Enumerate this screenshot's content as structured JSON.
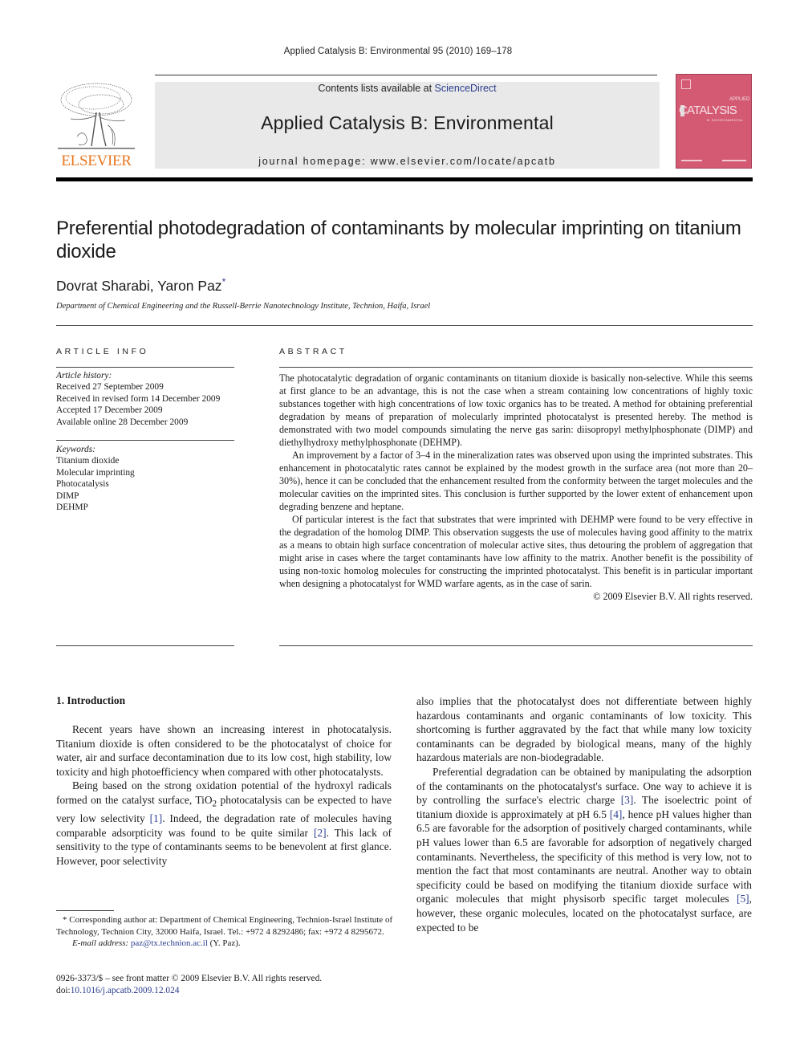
{
  "running_head": "Applied Catalysis B: Environmental 95 (2010) 169–178",
  "publisher": {
    "logo_word": "ELSEVIER",
    "logo_color": "#e87722"
  },
  "banner": {
    "contents_prefix": "Contents lists available at ",
    "contents_link": "ScienceDirect",
    "journal_name": "Applied Catalysis B: Environmental",
    "homepage": "journal homepage: www.elsevier.com/locate/apcatb"
  },
  "cover": {
    "applied": "APPLIED",
    "catalysis": "CATALYSIS",
    "subtitle": "B: ENVIRONMENTAL",
    "color": "#d45a73"
  },
  "article": {
    "title": "Preferential photodegradation of contaminants by molecular imprinting on titanium dioxide",
    "authors": "Dovrat Sharabi, Yaron Paz",
    "author_mark": "*",
    "affiliation": "Department of Chemical Engineering and the Russell-Berrie Nanotechnology Institute, Technion, Haifa, Israel"
  },
  "article_info": {
    "heading": "ARTICLE INFO",
    "history_label": "Article history:",
    "history": [
      "Received 27 September 2009",
      "Received in revised form 14 December 2009",
      "Accepted 17 December 2009",
      "Available online 28 December 2009"
    ],
    "keywords_label": "Keywords:",
    "keywords": [
      "Titanium dioxide",
      "Molecular imprinting",
      "Photocatalysis",
      "DIMP",
      "DEHMP"
    ]
  },
  "abstract": {
    "heading": "ABSTRACT",
    "paragraphs": [
      "The photocatalytic degradation of organic contaminants on titanium dioxide is basically non-selective. While this seems at first glance to be an advantage, this is not the case when a stream containing low concentrations of highly toxic substances together with high concentrations of low toxic organics has to be treated. A method for obtaining preferential degradation by means of preparation of molecularly imprinted photocatalyst is presented hereby. The method is demonstrated with two model compounds simulating the nerve gas sarin: diisopropyl methylphosphonate (DIMP) and diethylhydroxy methylphosphonate (DEHMP).",
      "An improvement by a factor of 3–4 in the mineralization rates was observed upon using the imprinted substrates. This enhancement in photocatalytic rates cannot be explained by the modest growth in the surface area (not more than 20–30%), hence it can be concluded that the enhancement resulted from the conformity between the target molecules and the molecular cavities on the imprinted sites. This conclusion is further supported by the lower extent of enhancement upon degrading benzene and heptane.",
      "Of particular interest is the fact that substrates that were imprinted with DEHMP were found to be very effective in the degradation of the homolog DIMP. This observation suggests the use of molecules having good affinity to the matrix as a means to obtain high surface concentration of molecular active sites, thus detouring the problem of aggregation that might arise in cases where the target contaminants have low affinity to the matrix. Another benefit is the possibility of using non-toxic homolog molecules for constructing the imprinted photocatalyst. This benefit is in particular important when designing a photocatalyst for WMD warfare agents, as in the case of sarin."
    ],
    "copyright": "© 2009 Elsevier B.V. All rights reserved."
  },
  "introduction": {
    "heading": "1.  Introduction",
    "left_col": {
      "p1": "Recent years have shown an increasing interest in photocatalysis. Titanium dioxide is often considered to be the photocatalyst of choice for water, air and surface decontamination due to its low cost, high stability, low toxicity and high photoefficiency when compared with other photocatalysts.",
      "p2_a": "Being based on the strong oxidation potential of the hydroxyl radicals formed on the catalyst surface, TiO",
      "p2_sub": "2",
      "p2_b": " photocatalysis can be expected to have very low selectivity ",
      "cite1": "[1]",
      "p2_c": ". Indeed, the degradation rate of molecules having comparable adsorpticity was found to be quite similar ",
      "cite2": "[2]",
      "p2_d": ". This lack of sensitivity to the type of contaminants seems to be benevolent at first glance. However, poor selectivity"
    },
    "right_col": {
      "p1": "also implies that the photocatalyst does not differentiate between highly hazardous contaminants and organic contaminants of low toxicity. This shortcoming is further aggravated by the fact that while many low toxicity contaminants can be degraded by biological means, many of the highly hazardous materials are non-biodegradable.",
      "p2_a": "Preferential degradation can be obtained by manipulating the adsorption of the contaminants on the photocatalyst's surface. One way to achieve it is by controlling the surface's electric charge ",
      "cite3": "[3]",
      "p2_b": ". The isoelectric point of titanium dioxide is approximately at pH 6.5 ",
      "cite4": "[4]",
      "p2_c": ", hence pH values higher than 6.5 are favorable for the adsorption of positively charged contaminants, while pH values lower than 6.5 are favorable for adsorption of negatively charged contaminants. Nevertheless, the specificity of this method is very low, not to mention the fact that most contaminants are neutral. Another way to obtain specificity could be based on modifying the titanium dioxide surface with organic molecules that might physisorb specific target molecules ",
      "cite5": "[5]",
      "p2_d": ", however, these organic molecules, located on the photocatalyst surface, are expected to be"
    }
  },
  "footnote": {
    "corresponding": "* Corresponding author at: Department of Chemical Engineering, Technion-Israel Institute of Technology, Technion City, 32000 Haifa, Israel. Tel.: +972 4 8292486; fax: +972 4 8295672.",
    "email_label": "E-mail address: ",
    "email": "paz@tx.technion.ac.il",
    "email_suffix": " (Y. Paz)."
  },
  "front_matter": {
    "issn_line": "0926-3373/$ – see front matter © 2009 Elsevier B.V. All rights reserved.",
    "doi_label": "doi:",
    "doi": "10.1016/j.apcatb.2009.12.024"
  },
  "colors": {
    "link": "#2b3d8f",
    "banner_bg": "#e9e9e9"
  }
}
